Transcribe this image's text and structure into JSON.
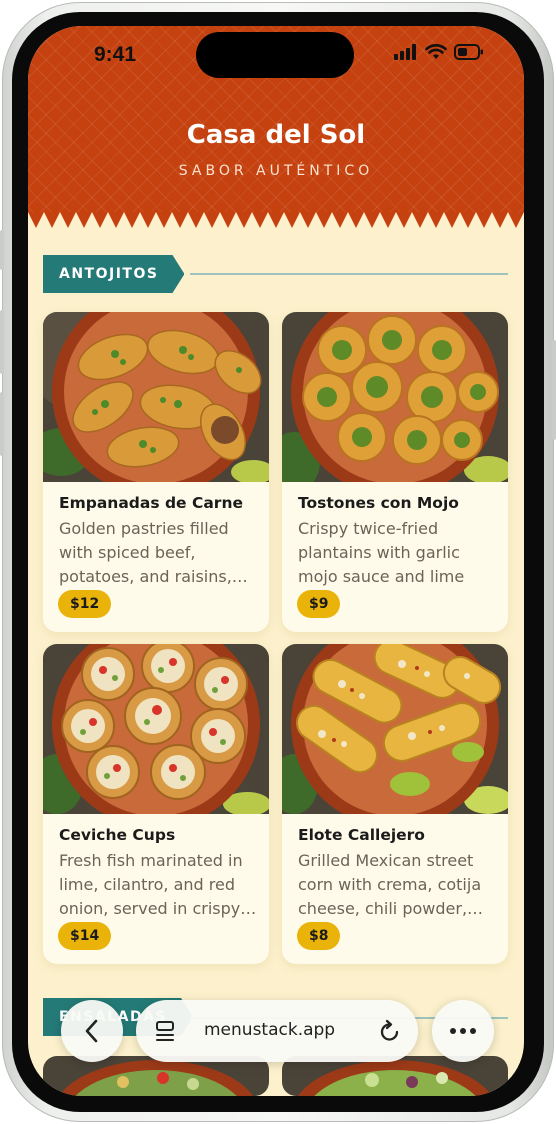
{
  "status_bar": {
    "time": "9:41"
  },
  "header": {
    "name": "Casa del Sol",
    "tagline": "SABOR AUTÉNTICO"
  },
  "sections": [
    {
      "label": "ANTOJITOS",
      "items": [
        {
          "name": "Empanadas de Carne",
          "description": "Golden pastries filled with spiced beef, potatoes, and raisins, served with salsa",
          "price": "$12"
        },
        {
          "name": "Tostones con Mojo",
          "description": "Crispy twice-fried plantains with garlic mojo sauce and lime",
          "price": "$9"
        },
        {
          "name": "Ceviche Cups",
          "description": "Fresh fish marinated in lime, cilantro, and red onion, served in crispy cups",
          "price": "$14"
        },
        {
          "name": "Elote Callejero",
          "description": "Grilled Mexican street corn with crema, cotija cheese, chili powder, and lime",
          "price": "$8"
        }
      ]
    },
    {
      "label": "ENSALADAS"
    }
  ],
  "browser": {
    "url": "menustack.app"
  },
  "colors": {
    "header": "#c5410f",
    "background": "#fcf1cc",
    "section_tag": "#247a76",
    "price_badge": "#e9b30a",
    "card": "#fffbea"
  },
  "icons": {
    "back": "chevron-left-icon",
    "tabs": "tabs-icon",
    "reload": "reload-icon",
    "more": "more-dots-icon",
    "signal": "signal-icon",
    "wifi": "wifi-icon",
    "battery": "battery-icon"
  }
}
